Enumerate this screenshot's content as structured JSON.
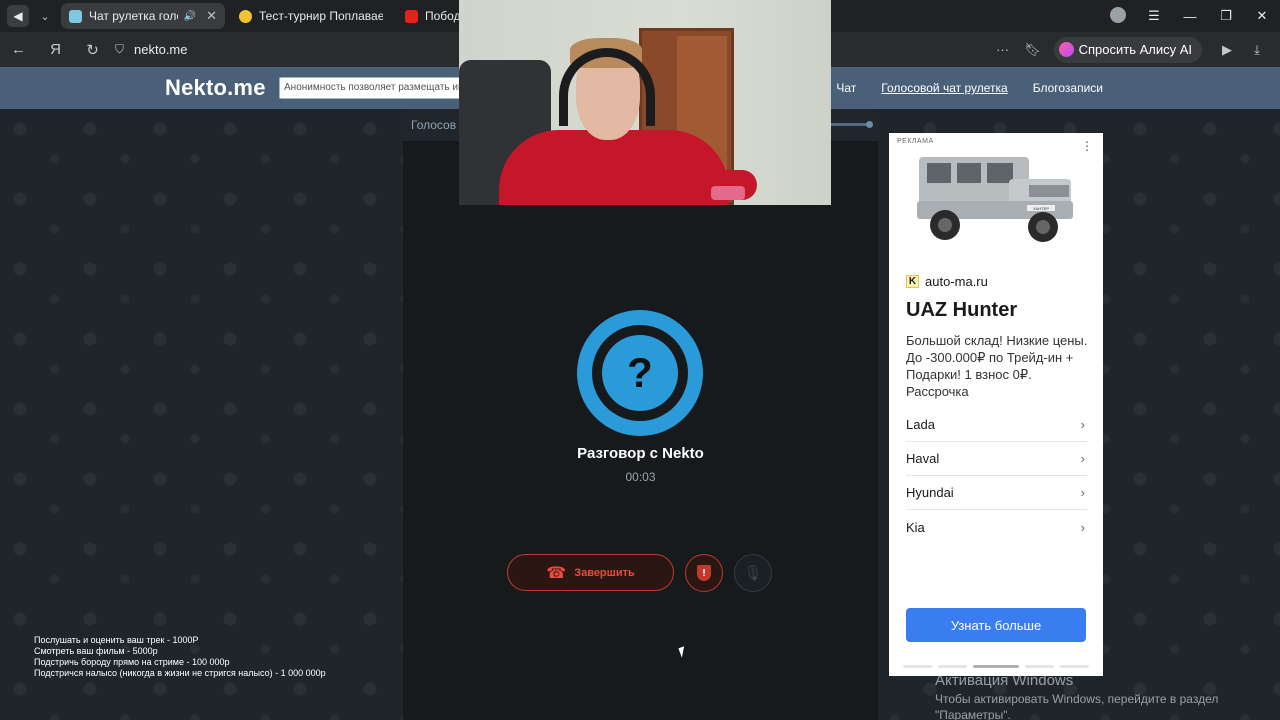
{
  "browser": {
    "tabs": [
      {
        "title": "Чат рулетка голосов",
        "active": true,
        "speaker": "🔊"
      },
      {
        "title": "Тест-турнир Поплаваешь",
        "active": false
      },
      {
        "title": "Побод",
        "active": false
      }
    ],
    "address": "nekto.me",
    "alice_label": "Спросить Алису AI",
    "colors": {
      "tabbar": "#202124",
      "addrbar": "#2a2b2e"
    }
  },
  "site": {
    "logo": "Nekto.me",
    "search_text": "Анонимность позволяет размещать инф",
    "nav": [
      {
        "label": "Чат",
        "underline": false
      },
      {
        "label": "Голосовой чат рулетка",
        "underline": true
      },
      {
        "label": "Блогозаписи",
        "underline": false
      }
    ],
    "header_color": "#4a6078"
  },
  "chat": {
    "panel_title": "Голосов",
    "avatar_symbol": "?",
    "title": "Разговор с Nekto",
    "timer": "00:03",
    "end_label": "Завершить",
    "accent": "#2b9ad8",
    "danger": "#e74c3c"
  },
  "ad": {
    "label": "РЕКЛАМА",
    "domain_letter": "K",
    "domain": "auto-ma.ru",
    "title": "UAZ Hunter",
    "text": "Большой склад! Низкие цены. До -300.000₽ по Трейд-ин + Подарки! 1 взнос 0₽. Рассрочка",
    "car_plate": "ХАНТЕР",
    "items": [
      "Lada",
      "Haval",
      "Hyundai",
      "Kia"
    ],
    "cta": "Узнать больше",
    "cta_color": "#3a7df0"
  },
  "stream_overlay": [
    "Послушать и оценить ваш трек - 1000Р",
    "Смотреть ваш фильм - 5000р",
    "Подстричь бороду прямо на стриме - 100 000р",
    "Подстричся налысо (никогда в жизни не стригся налысо) - 1 000 000р"
  ],
  "windows_activation": {
    "line1": "Активация Windows",
    "line2": "Чтобы активировать Windows, перейдите в раздел",
    "line3": "\"Параметры\"."
  }
}
